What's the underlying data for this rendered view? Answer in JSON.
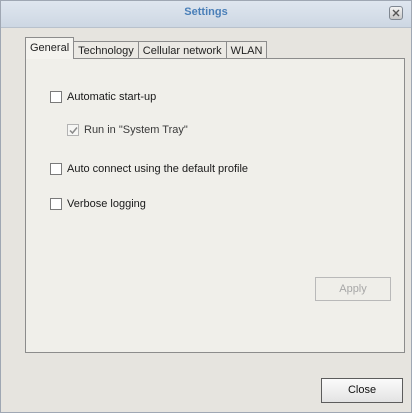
{
  "window": {
    "title": "Settings"
  },
  "tabs": [
    {
      "label": "General",
      "active": true
    },
    {
      "label": "Technology",
      "active": false
    },
    {
      "label": "Cellular network",
      "active": false
    },
    {
      "label": "WLAN",
      "active": false
    }
  ],
  "general": {
    "automatic_startup": {
      "label": "Automatic start-up",
      "checked": false,
      "enabled": true
    },
    "run_in_tray": {
      "label": "Run in \"System Tray\"",
      "checked": true,
      "enabled": false
    },
    "auto_connect": {
      "label": "Auto connect using the default profile",
      "checked": false,
      "enabled": true
    },
    "verbose_logging": {
      "label": "Verbose logging",
      "checked": false,
      "enabled": true
    }
  },
  "buttons": {
    "apply_label": "Apply",
    "apply_enabled": false,
    "close_label": "Close"
  },
  "icons": {
    "close": "close-icon",
    "check": "check-icon"
  }
}
